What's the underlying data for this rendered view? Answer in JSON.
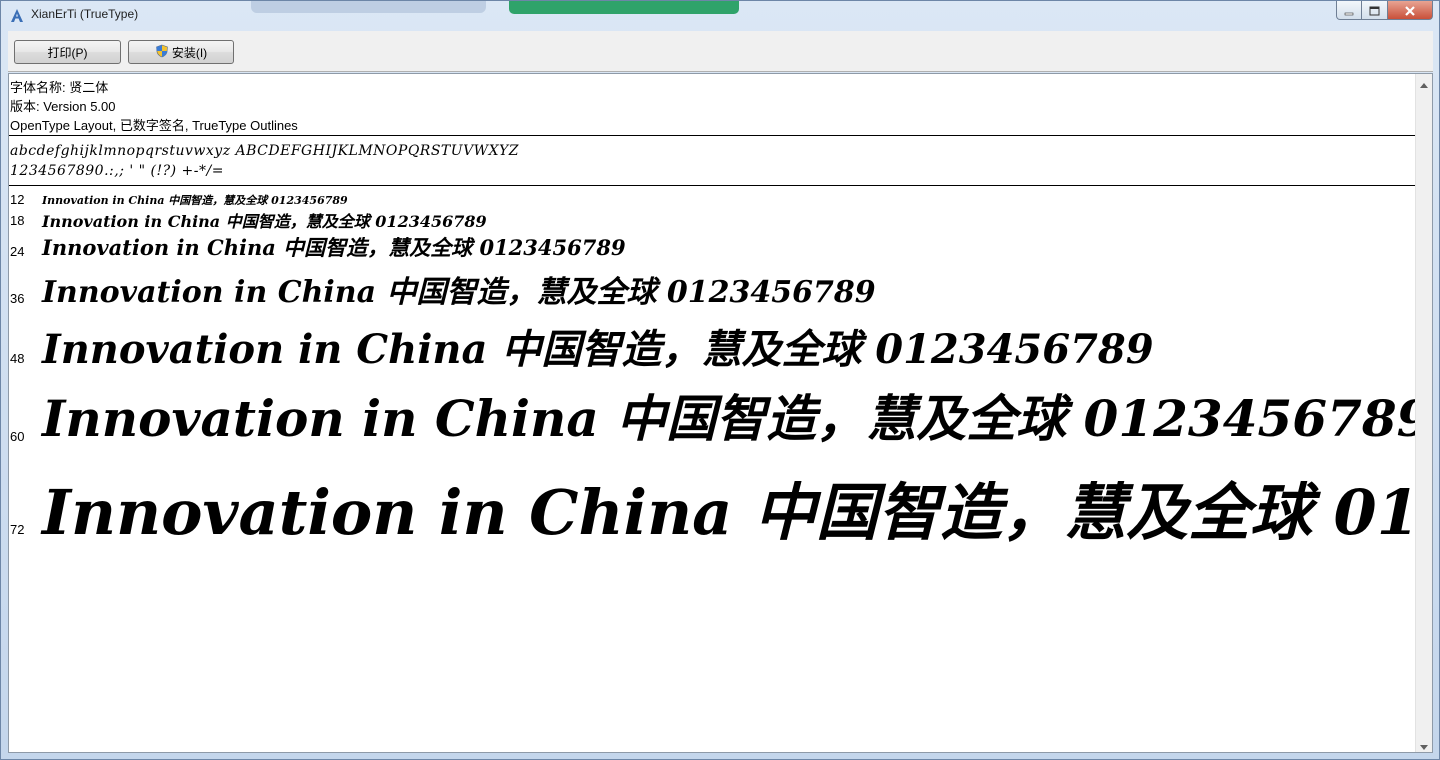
{
  "window": {
    "title": "XianErTi (TrueType)",
    "icons": {
      "app": "font-file-icon",
      "minimize": "minimize-icon",
      "maximize": "maximize-icon",
      "close": "close-icon"
    }
  },
  "toolbar": {
    "print_label": "打印(P)",
    "install_label": "安装(I)",
    "install_icon": "shield-icon"
  },
  "font_info": {
    "name_line": "字体名称: 贤二体",
    "version_line": "版本: Version 5.00",
    "type_line": "OpenType Layout, 已数字签名, TrueType Outlines"
  },
  "charset": {
    "letters": "abcdefghijklmnopqrstuvwxyz ABCDEFGHIJKLMNOPQRSTUVWXYZ",
    "digits_symbols": "1234567890.:,; ' \" (!?) +-*/="
  },
  "sample_text": "Innovation in China 中国智造，慧及全球 0123456789",
  "sizes": [
    "12",
    "18",
    "24",
    "36",
    "48",
    "60",
    "72"
  ]
}
